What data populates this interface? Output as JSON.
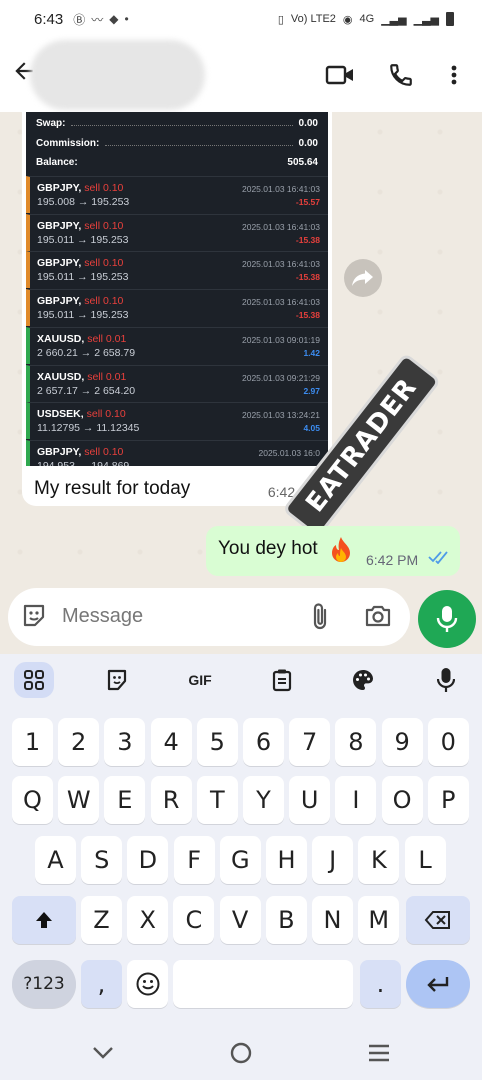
{
  "status_bar": {
    "time": "6:43",
    "network": "4G",
    "volte": "Vo) LTE2"
  },
  "header": {
    "back_icon": "arrow-left-icon",
    "video_icon": "video-call-icon",
    "call_icon": "phone-icon",
    "menu_icon": "more-vert-icon"
  },
  "trade_screenshot": {
    "summary": [
      {
        "label": "Swap:",
        "value": "0.00"
      },
      {
        "label": "Commission:",
        "value": "0.00"
      },
      {
        "label": "Balance:",
        "value": "505.64"
      }
    ],
    "trades": [
      {
        "symbol": "GBPJPY,",
        "side": "sell 0.10",
        "prices": "195.008 → 195.253",
        "date": "2025.01.03 16:41:03",
        "pl": "-15.57",
        "kind": "sell"
      },
      {
        "symbol": "GBPJPY,",
        "side": "sell 0.10",
        "prices": "195.011 → 195.253",
        "date": "2025.01.03 16:41:03",
        "pl": "-15.38",
        "kind": "sell"
      },
      {
        "symbol": "GBPJPY,",
        "side": "sell 0.10",
        "prices": "195.011 → 195.253",
        "date": "2025.01.03 16:41:03",
        "pl": "-15.38",
        "kind": "sell"
      },
      {
        "symbol": "GBPJPY,",
        "side": "sell 0.10",
        "prices": "195.011 → 195.253",
        "date": "2025.01.03 16:41:03",
        "pl": "-15.38",
        "kind": "sell"
      },
      {
        "symbol": "XAUUSD,",
        "side": "sell 0.01",
        "prices": "2 660.21 → 2 658.79",
        "date": "2025.01.03 09:01:19",
        "pl": "1.42",
        "kind": "buy"
      },
      {
        "symbol": "XAUUSD,",
        "side": "sell 0.01",
        "prices": "2 657.17 → 2 654.20",
        "date": "2025.01.03 09:21:29",
        "pl": "2.97",
        "kind": "buy"
      },
      {
        "symbol": "USDSEK,",
        "side": "sell 0.10",
        "prices": "11.12795 → 11.12345",
        "date": "2025.01.03 13:24:21",
        "pl": "4.05",
        "kind": "buy"
      },
      {
        "symbol": "GBPJPY,",
        "side": "sell 0.10",
        "prices": "194.953 → 194.869",
        "date": "2025.01.03 16:0",
        "pl": "",
        "kind": "buy"
      }
    ],
    "watermark": "EATRADER"
  },
  "messages": {
    "incoming": {
      "text": "My result for today",
      "time": "6:42 PM"
    },
    "outgoing": {
      "text": "You dey hot",
      "emoji": "fire-emoji",
      "time": "6:42 PM",
      "status": "read"
    }
  },
  "composer": {
    "placeholder": "Message",
    "emoji_icon": "sticker-icon",
    "attach_icon": "paperclip-icon",
    "camera_icon": "camera-icon",
    "mic_icon": "mic-icon",
    "accent": "#1fa855"
  },
  "keyboard": {
    "toolbar": [
      "apps-grid-icon",
      "sticker-icon",
      "GIF",
      "clipboard-icon",
      "palette-icon",
      "mic-icon"
    ],
    "gif_label": "GIF",
    "row_numbers": [
      "1",
      "2",
      "3",
      "4",
      "5",
      "6",
      "7",
      "8",
      "9",
      "0"
    ],
    "row1": [
      "Q",
      "W",
      "E",
      "R",
      "T",
      "Y",
      "U",
      "I",
      "O",
      "P"
    ],
    "row2": [
      "A",
      "S",
      "D",
      "F",
      "G",
      "H",
      "J",
      "K",
      "L"
    ],
    "row3": [
      "Z",
      "X",
      "C",
      "V",
      "B",
      "N",
      "M"
    ],
    "symbols_label": "?123",
    "comma": ",",
    "period": "."
  },
  "nav_bar": [
    "chevron-down-icon",
    "home-circle-icon",
    "recents-icon"
  ]
}
